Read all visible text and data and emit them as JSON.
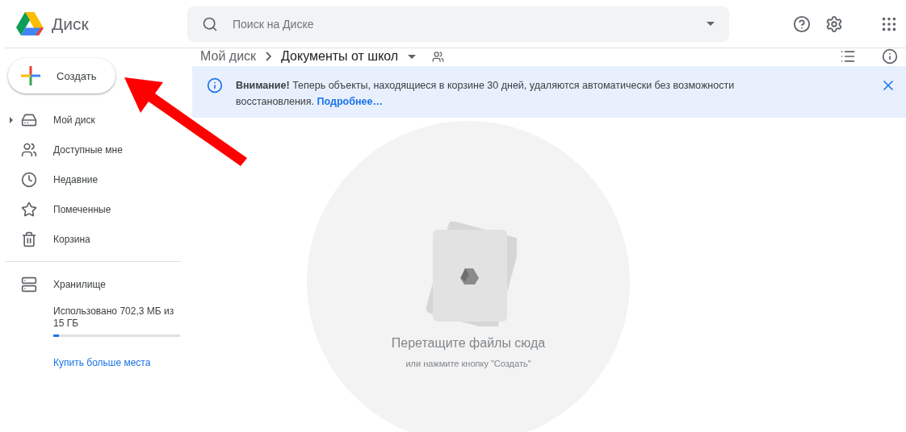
{
  "app": {
    "name": "Диск"
  },
  "search": {
    "placeholder": "Поиск на Диске"
  },
  "create_button": {
    "label": "Создать"
  },
  "sidebar": {
    "items": [
      {
        "label": "Мой диск",
        "expandable": true
      },
      {
        "label": "Доступные мне",
        "expandable": false
      },
      {
        "label": "Недавние",
        "expandable": false
      },
      {
        "label": "Помеченные",
        "expandable": false
      },
      {
        "label": "Корзина",
        "expandable": false
      }
    ],
    "storage": {
      "label": "Хранилище",
      "usage": "Использовано 702,3 МБ из 15 ГБ",
      "level": 0.045,
      "link": "Купить больше места"
    }
  },
  "breadcrumb": [
    {
      "label": "Мой диск"
    },
    {
      "label": "Документы от школ"
    }
  ],
  "notice": {
    "text": "**Внимание!** Теперь объекты, находящиеся в корзине 30 дней, удаляются автоматически без возможности восстановления.",
    "link": "Подробнее…"
  },
  "empty_state": {
    "title": "Перетащите файлы сюда",
    "subtitle": "или нажмите кнопку \"Создать\""
  }
}
